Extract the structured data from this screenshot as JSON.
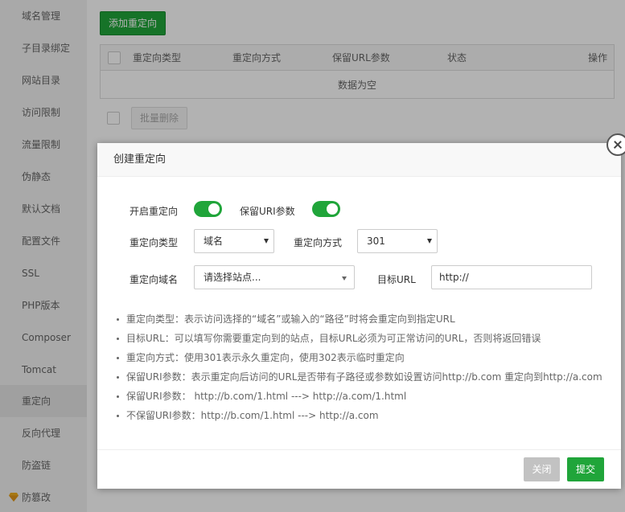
{
  "sidebar": {
    "items": [
      {
        "label": "域名管理"
      },
      {
        "label": "子目录绑定"
      },
      {
        "label": "网站目录"
      },
      {
        "label": "访问限制"
      },
      {
        "label": "流量限制"
      },
      {
        "label": "伪静态"
      },
      {
        "label": "默认文档"
      },
      {
        "label": "配置文件"
      },
      {
        "label": "SSL"
      },
      {
        "label": "PHP版本"
      },
      {
        "label": "Composer"
      },
      {
        "label": "Tomcat"
      },
      {
        "label": "重定向",
        "active": true
      },
      {
        "label": "反向代理"
      },
      {
        "label": "防盗链"
      },
      {
        "label": "防篡改",
        "icon": "gem-icon"
      }
    ]
  },
  "main": {
    "add_button": "添加重定向",
    "table": {
      "columns": [
        "重定向类型",
        "重定向方式",
        "保留URL参数",
        "状态",
        "操作"
      ],
      "empty_text": "数据为空"
    },
    "bulk_delete": "批量删除"
  },
  "dialog": {
    "title": "创建重定向",
    "enable_label": "开启重定向",
    "enable_on": true,
    "keep_params_label": "保留URI参数",
    "keep_params_on": true,
    "type_label": "重定向类型",
    "type_value": "域名",
    "method_label": "重定向方式",
    "method_value": "301",
    "domain_label": "重定向域名",
    "domain_placeholder": "请选择站点...",
    "target_label": "目标URL",
    "target_value": "http://",
    "tips": [
      "重定向类型：表示访问选择的“域名”或输入的“路径”时将会重定向到指定URL",
      "目标URL：可以填写你需要重定向到的站点，目标URL必须为可正常访问的URL，否则将返回错误",
      "重定向方式：使用301表示永久重定向，使用302表示临时重定向",
      "保留URI参数：表示重定向后访问的URL是否带有子路径或参数如设置访问http://b.com 重定向到http://a.com",
      "保留URI参数：  http://b.com/1.html ---> http://a.com/1.html",
      "不保留URI参数：http://b.com/1.html ---> http://a.com"
    ],
    "cancel_button": "关闭",
    "submit_button": "提交"
  },
  "colors": {
    "accent": "#20a53a",
    "disabled": "#c2c2c2"
  }
}
